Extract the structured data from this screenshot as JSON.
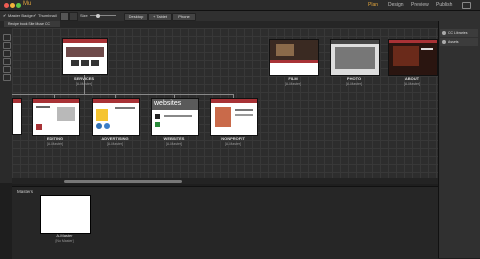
{
  "app": {
    "name": "Mu",
    "modes": [
      "Plan",
      "Design",
      "Preview",
      "Publish"
    ],
    "active_mode": "Plan",
    "accent": "#e0a43c"
  },
  "toolbar": {
    "master_badge": "Master Badge",
    "thumbnail": "Thumbnail",
    "size": "Size",
    "device_tabs": [
      "Desktop",
      "+ Tablet",
      "Phone"
    ]
  },
  "document": {
    "tab_label": "Recipe book Site Muse CC"
  },
  "canvas": {
    "pages": [
      {
        "name": "SERVICES",
        "master": "[A-Master]"
      },
      {
        "name": "FILM",
        "master": "[A-Master]"
      },
      {
        "name": "PHOTO",
        "master": "[A-Master]"
      },
      {
        "name": "ABOUT",
        "master": "[A-Master]"
      },
      {
        "name": "EDITING",
        "master": "[A-Master]"
      },
      {
        "name": "ADVERTISING",
        "master": "[A-Master]"
      },
      {
        "name": "WEBSITES",
        "master": "[A-Master]"
      },
      {
        "name": "NONPROFIT",
        "master": "[A-Master]"
      }
    ],
    "websites_thumb_text": "websites"
  },
  "masters": {
    "title": "Masters",
    "items": [
      {
        "name": "A-Master",
        "sub": "[No Master]"
      }
    ]
  },
  "right_panel": {
    "items": [
      "CC Libraries",
      "Assets"
    ]
  },
  "colors": {
    "brand_red": "#a83236"
  }
}
